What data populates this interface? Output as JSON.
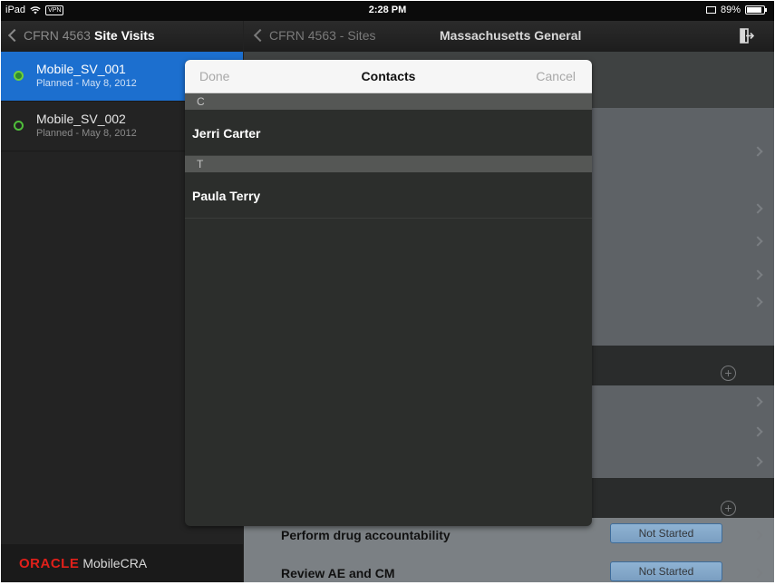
{
  "status_bar": {
    "device": "iPad",
    "vpn": "VPN",
    "time": "2:28 PM",
    "battery": "89%"
  },
  "master": {
    "back_label": "CFRN 4563",
    "title": "Site Visits",
    "items": [
      {
        "name": "Mobile_SV_001",
        "sub": "Planned - May 8, 2012",
        "selected": true
      },
      {
        "name": "Mobile_SV_002",
        "sub": "Planned - May 8, 2012",
        "selected": false
      }
    ],
    "footer": {
      "logo": "ORACLE",
      "product": "MobileCRA"
    }
  },
  "detail": {
    "back_label": "CFRN 4563 - Sites",
    "title": "Massachusetts General",
    "tasks": [
      {
        "label": "Perform drug accountability",
        "status": "Not Started"
      },
      {
        "label": "Review AE and CM",
        "status": "Not Started"
      }
    ]
  },
  "popover": {
    "done_label": "Done",
    "title": "Contacts",
    "cancel_label": "Cancel",
    "sections": [
      {
        "header": "C",
        "contacts": [
          "Jerri Carter"
        ]
      },
      {
        "header": "T",
        "contacts": [
          "Paula Terry"
        ]
      }
    ]
  },
  "colors": {
    "selected_row": "#1c6fcf",
    "oracle_red": "#e0201a",
    "status_button": "#8fb3d3"
  }
}
